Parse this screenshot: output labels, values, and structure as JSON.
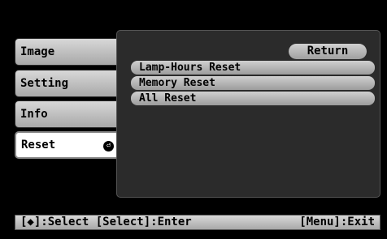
{
  "sidebar": {
    "items": [
      {
        "label": "Image"
      },
      {
        "label": "Setting"
      },
      {
        "label": "Info"
      },
      {
        "label": "Reset",
        "selected": true,
        "icon": "enter-icon"
      }
    ]
  },
  "panel": {
    "return_label": "Return",
    "options": [
      "Lamp-Hours Reset",
      "Memory Reset",
      "All Reset"
    ]
  },
  "statusbar": {
    "left": "[◆]:Select [Select]:Enter",
    "right": "[Menu]:Exit"
  },
  "colors": {
    "background": "#000000",
    "button": "#c0c0c0",
    "panel": "#2b2b2b"
  }
}
